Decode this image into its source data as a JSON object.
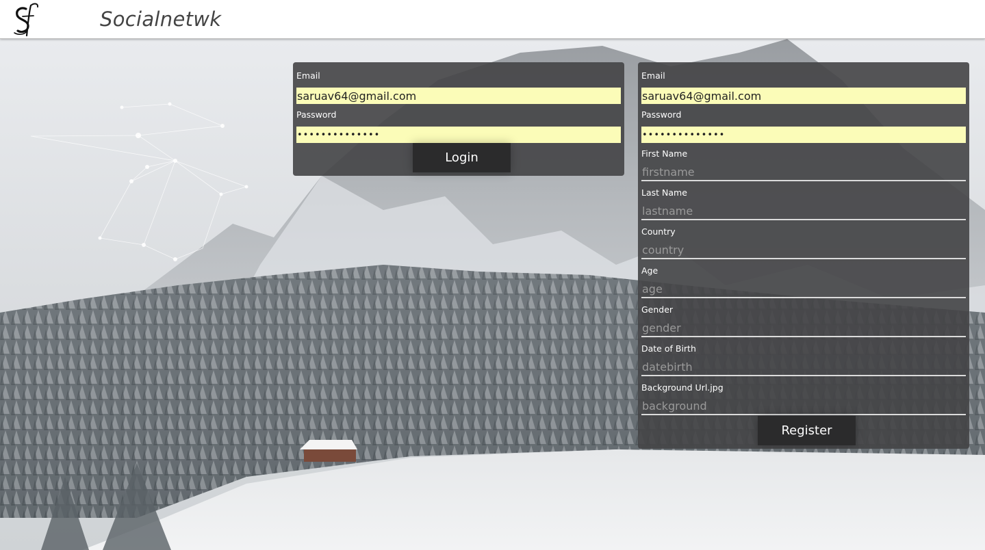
{
  "header": {
    "brand": "Socialnetwk",
    "logo_icon": "script-sf-logo-icon"
  },
  "login": {
    "email_label": "Email",
    "email_value": "saruav64@gmail.com",
    "password_label": "Password",
    "password_value": "••••••••••••••",
    "button_label": "Login"
  },
  "register": {
    "email_label": "Email",
    "email_value": "saruav64@gmail.com",
    "password_label": "Password",
    "password_value": "••••••••••••••",
    "firstname_label": "First Name",
    "firstname_placeholder": "firstname",
    "lastname_label": "Last Name",
    "lastname_placeholder": "lastname",
    "country_label": "Country",
    "country_placeholder": "country",
    "age_label": "Age",
    "age_placeholder": "age",
    "gender_label": "Gender",
    "gender_placeholder": "gender",
    "datebirth_label": "Date of Birth",
    "datebirth_placeholder": "datebirth",
    "background_label": "Background Url.jpg",
    "background_placeholder": "background",
    "button_label": "Register"
  },
  "colors": {
    "panel_bg": "#444446",
    "autofill_bg": "#fbfcb8",
    "button_bg": "#2b2b2c"
  }
}
